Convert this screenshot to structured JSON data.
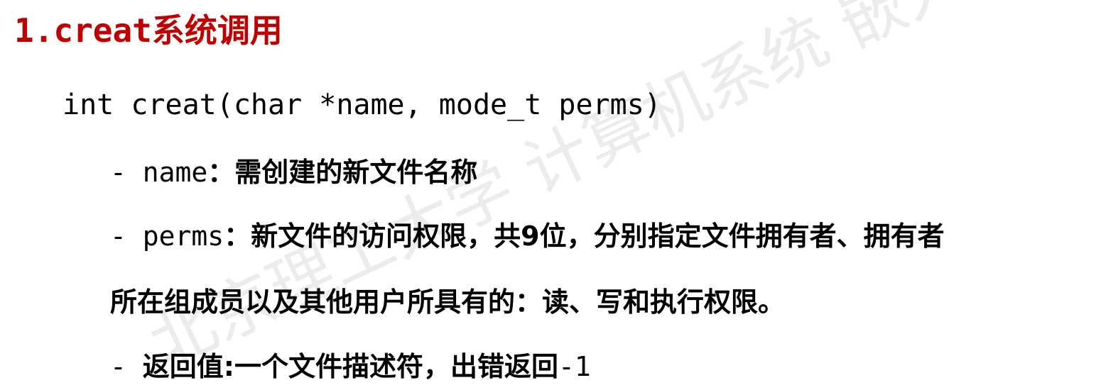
{
  "title": {
    "prefix": "1.creat",
    "suffix": "系统调用"
  },
  "signature": "int creat(char *name, mode_t perms)",
  "params": [
    {
      "dash_name": "- name",
      "description": "：需创建的新文件名称"
    },
    {
      "dash_name": "- perms",
      "description": "：新文件的访问权限，共9位，分别指定文件拥有者、拥有者"
    },
    {
      "continuation": "所在组成员以及其他用户所具有的：读、写和执行权限。"
    },
    {
      "dash": "- ",
      "label": "返回值:一个文件描述符，出错返回",
      "value": "-1"
    }
  ],
  "watermark": {
    "text": "北京理工大学 计算机系统 嵌入",
    "color": "#e6e6e6"
  }
}
